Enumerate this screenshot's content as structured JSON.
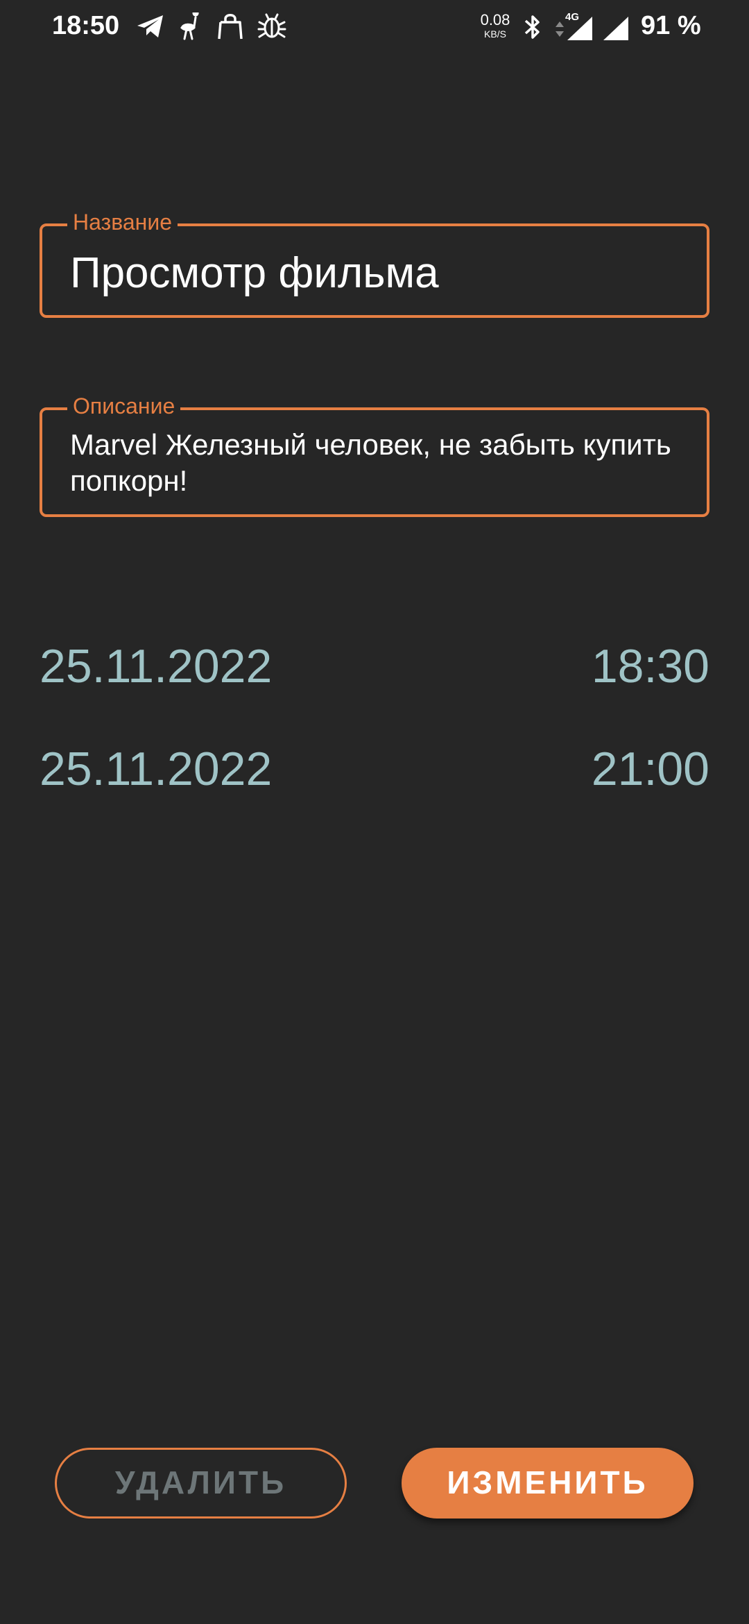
{
  "status_bar": {
    "time": "18:50",
    "notification_icons": [
      "telegram-icon",
      "ostrich-icon",
      "shopping-bag-icon",
      "bug-icon"
    ],
    "net_speed": "0.08",
    "net_speed_unit": "KB/S",
    "network_type": "4G",
    "system_icons": [
      "bluetooth-icon",
      "mobile-signal-icon",
      "wifi-signal-icon"
    ],
    "battery": "91 %"
  },
  "form": {
    "title_label": "Название",
    "title_value": "Просмотр фильма",
    "description_label": "Описание",
    "description_value": "Marvel Железный человек, не забыть купить попкорн!"
  },
  "schedule": {
    "start_date": "25.11.2022",
    "start_time": "18:30",
    "end_date": "25.11.2022",
    "end_time": "21:00"
  },
  "actions": {
    "delete_label": "УДАЛИТЬ",
    "edit_label": "ИЗМЕНИТЬ"
  },
  "colors": {
    "background": "#262626",
    "accent": "#e67f43",
    "date_text": "#9fc3c6",
    "disabled_text": "#6d7678"
  }
}
